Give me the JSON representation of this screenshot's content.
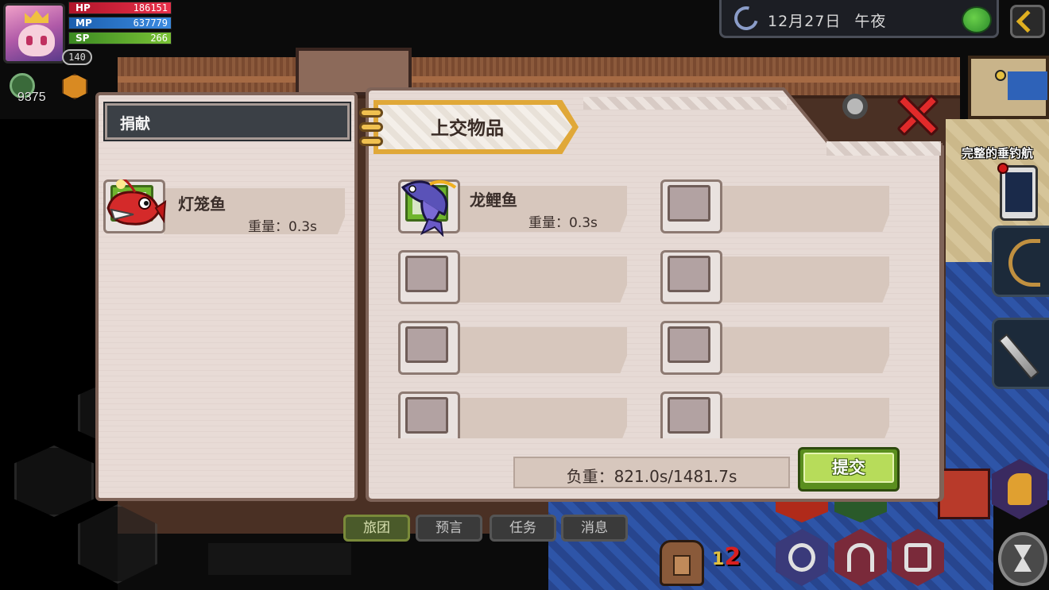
{
  "hud": {
    "hp_label": "HP",
    "hp_value": "186151",
    "mp_label": "MP",
    "mp_value": "637779",
    "sp_label": "SP",
    "sp_value": "266",
    "level": "140",
    "coins": "9375",
    "date": "12月27日",
    "time_of_day": "午夜",
    "quest_label": "完整的垂钓航"
  },
  "donate_panel": {
    "header": "捐献",
    "items": [
      {
        "name": "灯笼鱼",
        "weight": "重量：0.3s",
        "icon": "lantern-fish-icon"
      }
    ]
  },
  "submit_panel": {
    "title": "上交物品",
    "slots": [
      {
        "name": "龙鲤鱼",
        "weight": "重量：0.3s",
        "icon": "dragon-carp-icon"
      },
      {
        "name": "",
        "weight": ""
      },
      {
        "name": "",
        "weight": ""
      },
      {
        "name": "",
        "weight": ""
      },
      {
        "name": "",
        "weight": ""
      },
      {
        "name": "",
        "weight": ""
      },
      {
        "name": "",
        "weight": ""
      },
      {
        "name": "",
        "weight": ""
      }
    ],
    "load": "负重：821.0s/1481.7s",
    "submit_label": "提交"
  },
  "chat_tabs": [
    "旅团",
    "预言",
    "任务",
    "消息"
  ],
  "bag": {
    "count_main": "2",
    "count_small": "1"
  },
  "colors": {
    "hp": "#e8304a",
    "mp": "#3a8ae0",
    "sp": "#7ac236",
    "submit": "#b7dc5a",
    "panel": "#e8dbd6",
    "close": "#e02a2a"
  }
}
